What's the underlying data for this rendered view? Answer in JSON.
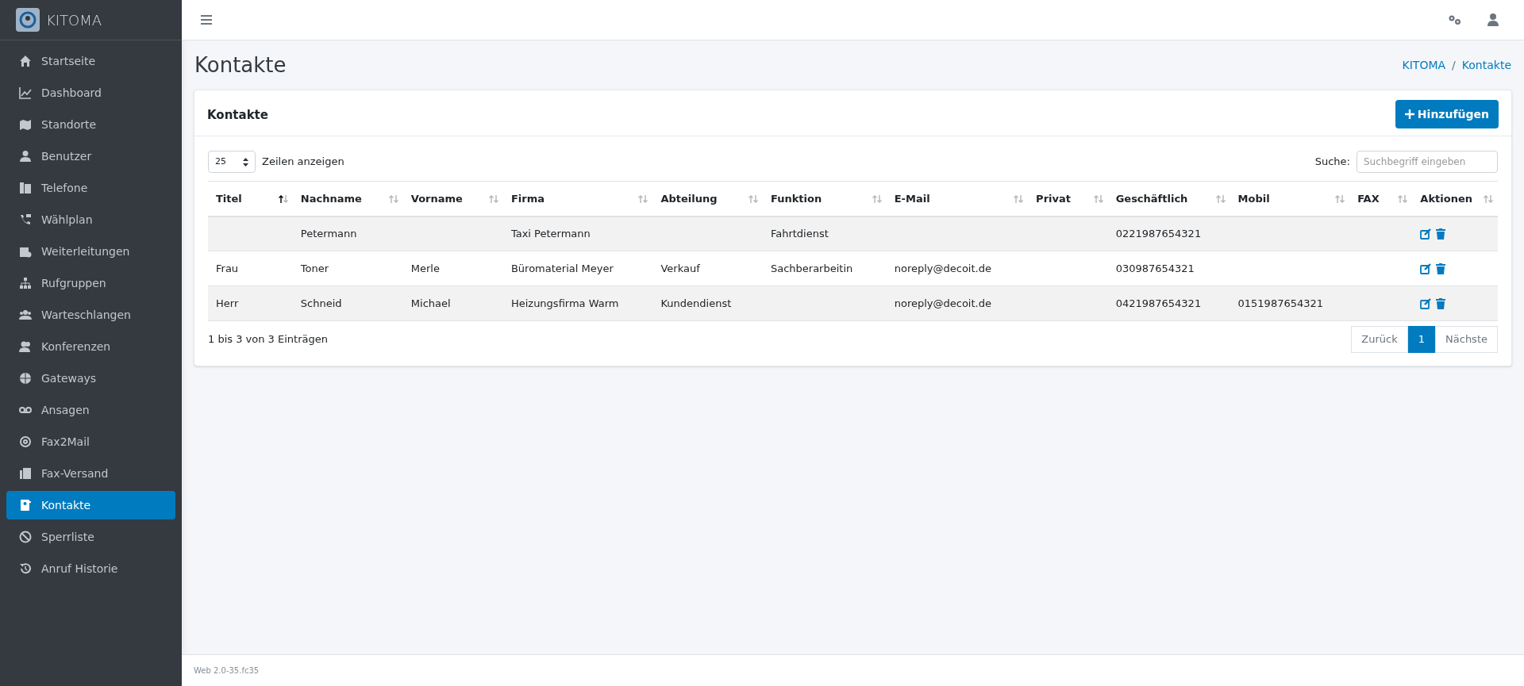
{
  "brand": "KITOMA",
  "sidebar": {
    "items": [
      {
        "label": "Startseite",
        "selected": false
      },
      {
        "label": "Dashboard",
        "selected": false
      },
      {
        "label": "Standorte",
        "selected": false
      },
      {
        "label": "Benutzer",
        "selected": false
      },
      {
        "label": "Telefone",
        "selected": false
      },
      {
        "label": "Wählplan",
        "selected": false
      },
      {
        "label": "Weiterleitungen",
        "selected": false
      },
      {
        "label": "Rufgruppen",
        "selected": false
      },
      {
        "label": "Warteschlangen",
        "selected": false
      },
      {
        "label": "Konferenzen",
        "selected": false
      },
      {
        "label": "Gateways",
        "selected": false
      },
      {
        "label": "Ansagen",
        "selected": false
      },
      {
        "label": "Fax2Mail",
        "selected": false
      },
      {
        "label": "Fax-Versand",
        "selected": false
      },
      {
        "label": "Kontakte",
        "selected": true
      },
      {
        "label": "Sperrliste",
        "selected": false
      },
      {
        "label": "Anruf Historie",
        "selected": false
      }
    ]
  },
  "page_title": "Kontakte",
  "breadcrumb": [
    "KITOMA",
    "/",
    "Kontakte"
  ],
  "card": {
    "title": "Kontakte",
    "add_button": "Hinzufügen",
    "page_length": {
      "value": "25",
      "label": "Zeilen anzeigen"
    },
    "search": {
      "label": "Suche:",
      "placeholder": "Suchbegriff eingeben"
    },
    "table": {
      "columns": [
        {
          "label": "Titel",
          "sorted": true
        },
        {
          "label": "Nachname",
          "sorted": false
        },
        {
          "label": "Vorname",
          "sorted": false
        },
        {
          "label": "Firma",
          "sorted": false
        },
        {
          "label": "Abteilung",
          "sorted": false
        },
        {
          "label": "Funktion",
          "sorted": false
        },
        {
          "label": "E-Mail",
          "sorted": false
        },
        {
          "label": "Privat",
          "sorted": false
        },
        {
          "label": "Geschäftlich",
          "sorted": false
        },
        {
          "label": "Mobil",
          "sorted": false
        },
        {
          "label": "FAX",
          "sorted": false
        },
        {
          "label": "Aktionen",
          "sorted": false
        }
      ],
      "rows": [
        [
          "",
          "Petermann",
          "",
          "Taxi Petermann",
          "",
          "Fahrtdienst",
          "",
          "",
          "0221987654321",
          "",
          ""
        ],
        [
          "Frau",
          "Toner",
          "Merle",
          "Büromaterial Meyer",
          "Verkauf",
          "Sachberarbeitin",
          "noreply@decoit.de",
          "",
          "030987654321",
          "",
          ""
        ],
        [
          "Herr",
          "Schneid",
          "Michael",
          "Heizungsfirma Warm",
          "Kundendienst",
          "",
          "noreply@decoit.de",
          "",
          "0421987654321",
          "0151987654321",
          ""
        ]
      ]
    },
    "info": "1 bis 3 von 3 Einträgen",
    "pagination": [
      {
        "label": "Zurück",
        "selected": false
      },
      {
        "label": "1",
        "selected": true
      },
      {
        "label": "Nächste",
        "selected": false
      }
    ]
  },
  "footer": "Web 2.0-35.fc35"
}
